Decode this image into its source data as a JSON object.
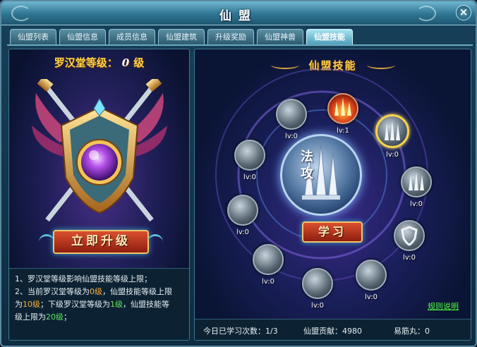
{
  "window": {
    "title": "仙盟",
    "close_label": "×"
  },
  "tabs": [
    {
      "label": "仙盟列表",
      "active": false
    },
    {
      "label": "仙盟信息",
      "active": false
    },
    {
      "label": "成员信息",
      "active": false
    },
    {
      "label": "仙盟建筑",
      "active": false
    },
    {
      "label": "升级奖励",
      "active": false
    },
    {
      "label": "仙盟神兽",
      "active": false
    },
    {
      "label": "仙盟技能",
      "active": true
    }
  ],
  "left": {
    "level_prefix": "罗汉堂等级：",
    "level_value": "0",
    "level_suffix": "级",
    "upgrade_label": "立即升级",
    "desc": {
      "line1": "1、罗汉堂等级影响仙盟技能等级上限；",
      "line2_a": "2、当前罗汉堂等级为",
      "line2_b": "0级",
      "line2_c": "，仙盟技能等级上限",
      "line3_a": "为",
      "line3_b": "10级",
      "line3_c": "；下级罗汉堂等级为",
      "line3_d": "1级",
      "line3_e": "，仙盟技能等",
      "line4_a": "级上限为",
      "line4_b": "20级",
      "line4_c": "；"
    }
  },
  "right": {
    "heading": "仙盟技能",
    "center_chars": [
      "法",
      "攻"
    ],
    "learn_label": "学习",
    "rules_label": "规则说明",
    "skills": [
      {
        "name": "skill-wave-burst",
        "level": "lv:0",
        "icon": "swirl-icon"
      },
      {
        "name": "skill-fire-swords",
        "level": "lv:1",
        "icon": "fire-swords-icon"
      },
      {
        "name": "skill-triple-swords",
        "level": "lv:0",
        "icon": "swords-icon",
        "selected": true
      },
      {
        "name": "skill-tornado",
        "level": "lv:0",
        "icon": "tornado-icon"
      },
      {
        "name": "skill-sword-rain",
        "level": "lv:0",
        "icon": "swords-icon"
      },
      {
        "name": "skill-thunder",
        "level": "lv:0",
        "icon": "thunder-icon"
      },
      {
        "name": "skill-shield",
        "level": "lv:0",
        "icon": "shield-icon"
      },
      {
        "name": "skill-tide",
        "level": "lv:0",
        "icon": "wave-icon"
      },
      {
        "name": "skill-phoenix",
        "level": "lv:0",
        "icon": "phoenix-icon"
      },
      {
        "name": "skill-surge",
        "level": "lv:0",
        "icon": "wave-icon"
      }
    ],
    "footer": {
      "study_count": "今日已学习次数：1/3",
      "contribution": "仙盟贡献：4980",
      "pills": "易筋丸：0"
    }
  },
  "colors": {
    "gold": "#ffd24a",
    "highlight_orange": "#ffb13b",
    "highlight_green": "#5fe65f",
    "link_green": "#4dff3c"
  }
}
